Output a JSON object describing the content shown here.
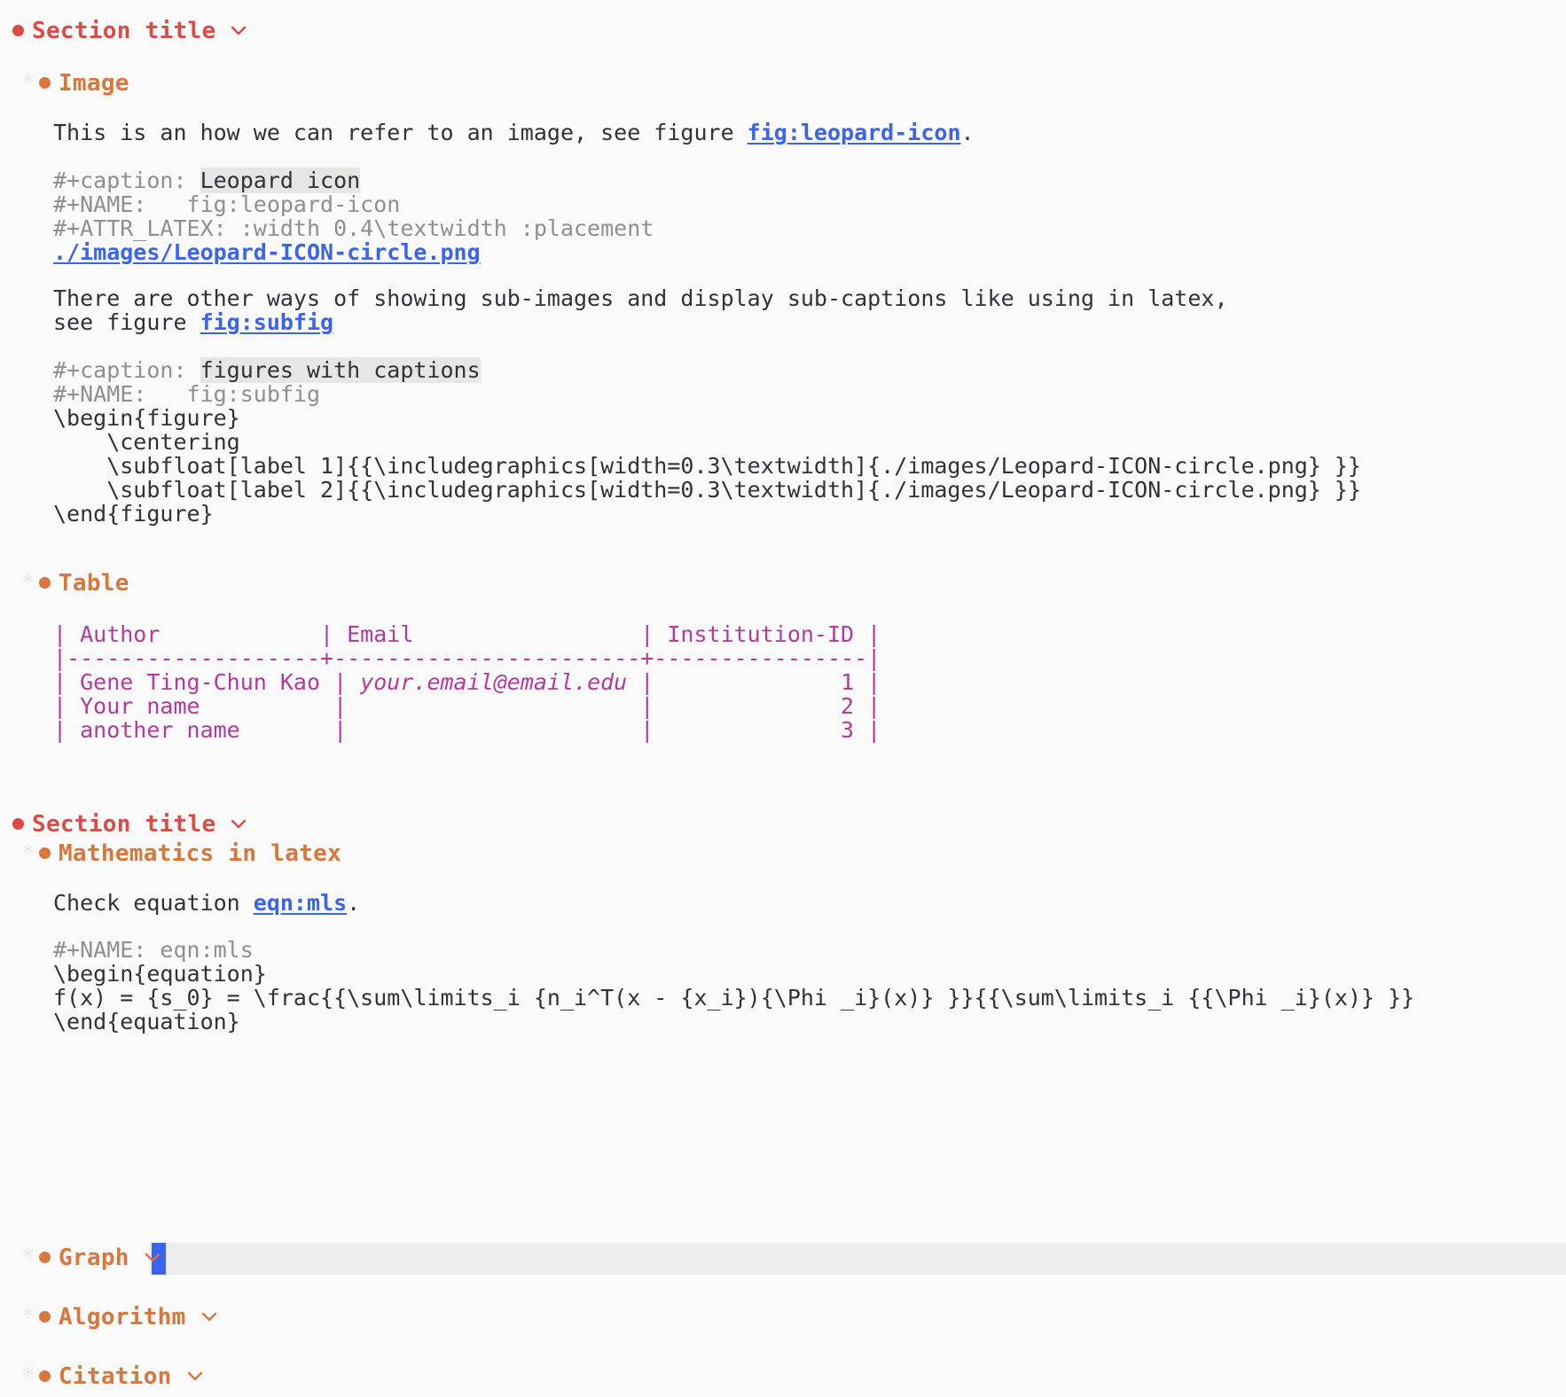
{
  "editor": {
    "kind": "org-mode-buffer",
    "background": "#fafafa",
    "foreground": "#2e3338",
    "heading1_color": "#dc4a44",
    "heading2_color": "#d9763c",
    "keyword_color": "#8f8f8f",
    "link_color": "#3a63f0",
    "table_color": "#b3399f",
    "cursor_color": "#3a63f0",
    "current_line_color": "#ededed",
    "caption_highlight_color": "#e6e6e6"
  },
  "headings": {
    "section_title_1": "Section title",
    "image": "Image",
    "table": "Table",
    "section_title_2": "Section title",
    "mathematics": "Mathematics in latex",
    "graph": "Graph",
    "algorithm": "Algorithm",
    "citation": "Citation",
    "hidden_star": "*",
    "chevron": "chevron-down-icon"
  },
  "image_section": {
    "intro_before": "This is an how we can refer to an image, see figure ",
    "intro_link": "fig:leopard-icon",
    "intro_after": ".",
    "caption_kw": "#+caption: ",
    "caption_value": "Leopard icon",
    "name_kw": "#+NAME:   fig:leopard-icon",
    "attr_kw": "#+ATTR_LATEX: :width 0.4\\textwidth :placement",
    "file_link": "./images/Leopard-ICON-circle.png",
    "subfig_text_1": "There are other ways of showing sub-images and display sub-captions like using in latex,",
    "subfig_text_2_before": "see figure ",
    "subfig_text_2_link": "fig:subfig",
    "caption2_kw": "#+caption: ",
    "caption2_value": "figures with captions",
    "name2_kw": "#+NAME:   fig:subfig",
    "latex_lines": [
      "\\begin{figure}",
      "    \\centering",
      "    \\subfloat[label 1]{{\\includegraphics[width=0.3\\textwidth]{./images/Leopard-ICON-circle.png} }}",
      "    \\subfloat[label 2]{{\\includegraphics[width=0.3\\textwidth]{./images/Leopard-ICON-circle.png} }}",
      "\\end{figure}"
    ]
  },
  "table_section": {
    "header_line": "| Author            | Email                 | Institution-ID |",
    "rule_line": "|-------------------+-----------------------+----------------|",
    "columns": [
      "Author",
      "Email",
      "Institution-ID"
    ],
    "rows": [
      {
        "author": "Gene Ting-Chun Kao",
        "email": "your.email@email.edu",
        "id": "1",
        "email_italic": true
      },
      {
        "author": "Your name",
        "email": "",
        "id": "2",
        "email_italic": false
      },
      {
        "author": "another name",
        "email": "",
        "id": "3",
        "email_italic": false
      }
    ],
    "row_lines": [
      "| Gene Ting-Chun Kao | your.email@email.edu |              1 |",
      "| Your name          |                      |              2 |",
      "| another name       |                      |              3 |"
    ]
  },
  "math_section": {
    "check_before": "Check equation ",
    "check_link": "eqn:mls",
    "check_after": ".",
    "name_kw": "#+NAME: eqn:mls",
    "latex_lines": [
      "\\begin{equation}",
      "f(x) = {s_0} = \\frac{{\\sum\\limits_i {n_i^T(x - {x_i}){\\Phi _i}(x)} }}{{\\sum\\limits_i {{\\Phi _i}(x)} }}",
      "\\end{equation}"
    ]
  }
}
